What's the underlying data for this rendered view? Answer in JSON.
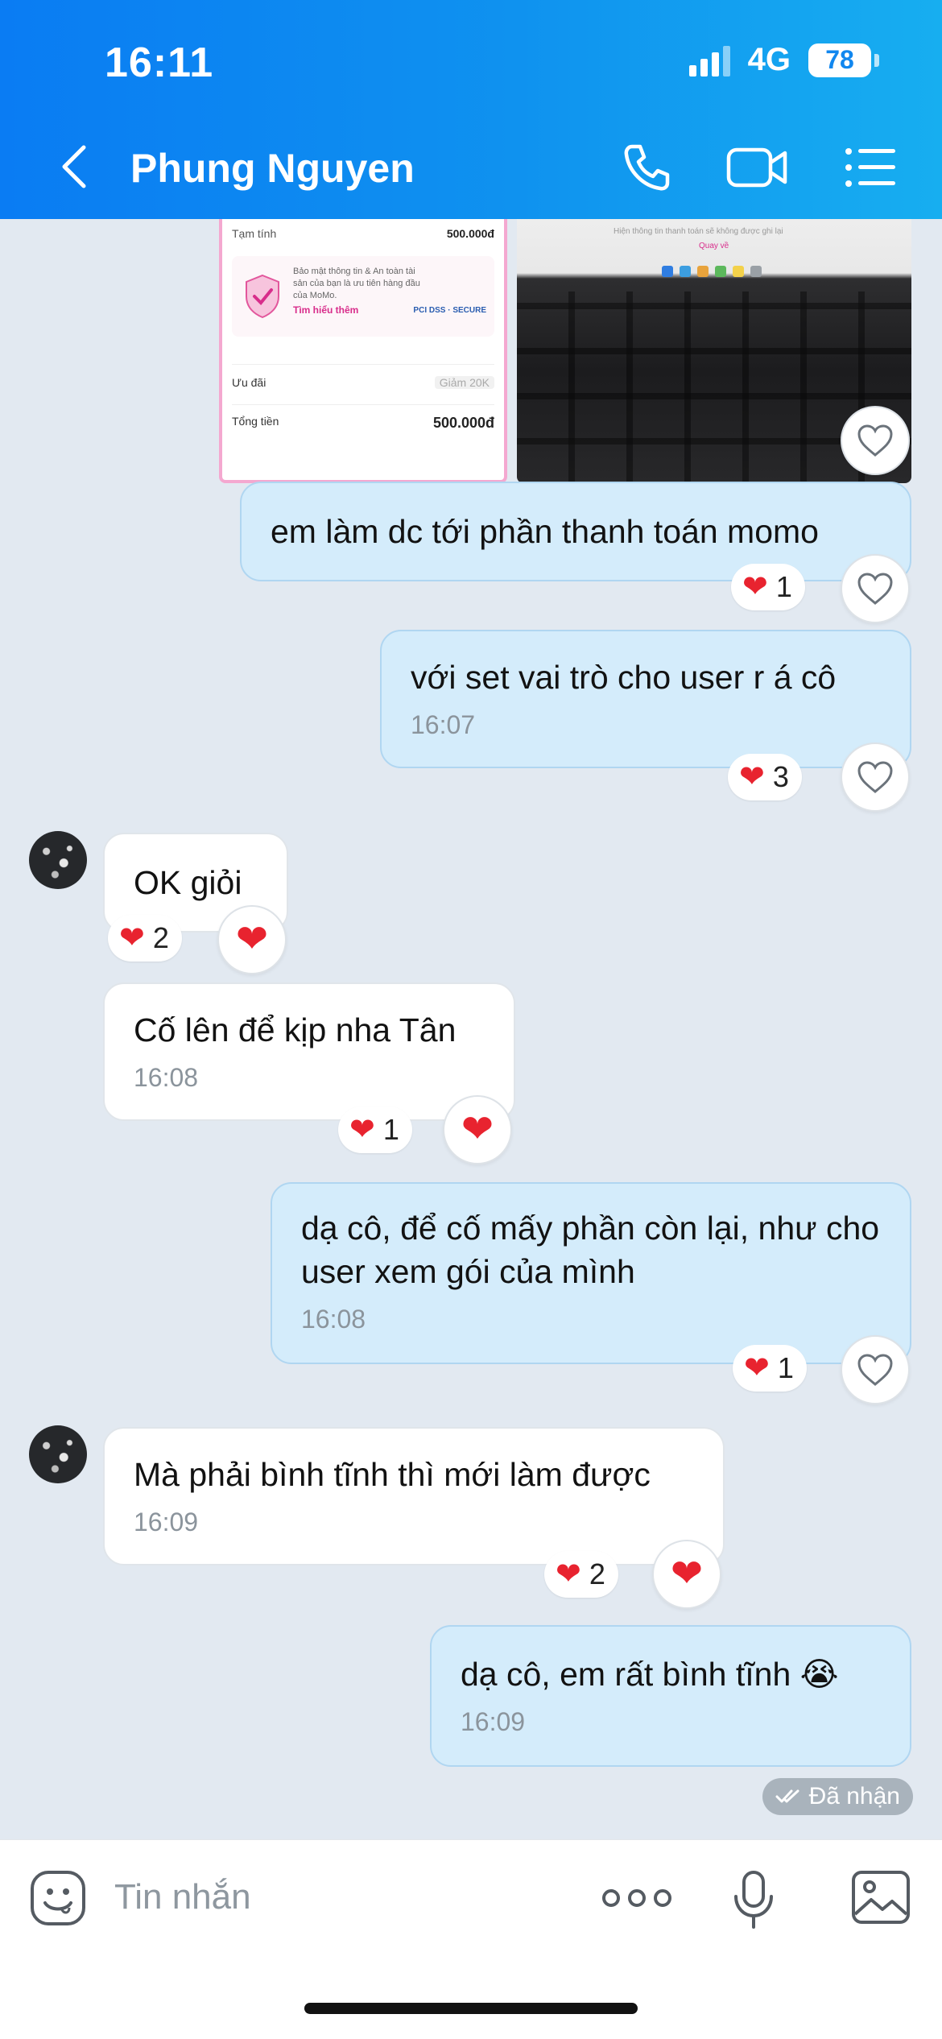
{
  "status_bar": {
    "time": "16:11",
    "network": "4G",
    "battery": "78"
  },
  "header": {
    "title": "Phung Nguyen"
  },
  "attachments": {
    "momo": {
      "subtotal_label": "Tạm tính",
      "subtotal_value": "500.000đ",
      "notice_text": "Bảo mật thông tin & An toàn tài sản của bạn là ưu tiên hàng đầu của MoMo.",
      "notice_link": "Tìm hiểu thêm",
      "partners": "PCI DSS · SECURE",
      "promo_label": "Ưu đãi",
      "promo_value": "Giảm 20K",
      "total_label": "Tổng tiền",
      "total_value": "500.000đ"
    },
    "photo": {
      "screen_text": "Hiện thông tin thanh toán sẽ không được ghi lại",
      "screen_link": "Quay về"
    }
  },
  "messages": [
    {
      "side": "out",
      "text": "em làm dc tới phần thanh toán momo",
      "time": "",
      "reaction": "1"
    },
    {
      "side": "out",
      "text": "với set vai trò cho user r á cô",
      "time": "16:07",
      "reaction": "3"
    },
    {
      "side": "in",
      "text": "OK giỏi",
      "time": "",
      "reaction": "2"
    },
    {
      "side": "in",
      "text": "Cố lên để kịp nha Tân",
      "time": "16:08",
      "reaction": "1"
    },
    {
      "side": "out",
      "text": "dạ cô, để cố mấy phần còn lại, như cho user xem gói của mình",
      "time": "16:08",
      "reaction": "1"
    },
    {
      "side": "in",
      "text": "Mà phải bình tĩnh thì mới làm được",
      "time": "16:09",
      "reaction": "2"
    },
    {
      "side": "out",
      "text": "dạ cô, em rất bình tĩnh 😭",
      "time": "16:09",
      "reaction": ""
    }
  ],
  "delivery_status": "Đã nhận",
  "input": {
    "placeholder": "Tin nhắn"
  },
  "colors": {
    "header_start": "#0a7cf3",
    "header_end": "#17aef0",
    "outgoing_bubble": "#d4ecfb",
    "incoming_bubble": "#ffffff",
    "heart": "#e8232f",
    "background": "#e2e9f1"
  },
  "icons": [
    "back-arrow-icon",
    "phone-icon",
    "video-call-icon",
    "menu-list-icon",
    "heart-icon",
    "heart-outline-icon",
    "emoji-icon",
    "more-dots-icon",
    "microphone-icon",
    "image-icon",
    "double-check-icon"
  ]
}
